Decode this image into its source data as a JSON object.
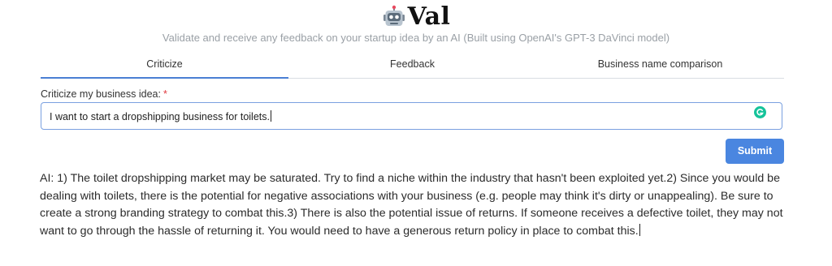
{
  "app": {
    "icon": "robot-icon",
    "name": "Val",
    "subtitle": "Validate and receive any feedback on your startup idea by an AI (Built using OpenAI's GPT-3 DaVinci model)"
  },
  "tabs": [
    {
      "label": "Criticize",
      "active": true
    },
    {
      "label": "Feedback",
      "active": false
    },
    {
      "label": "Business name comparison",
      "active": false
    }
  ],
  "form": {
    "label": "Criticize my business idea:",
    "required_marker": "*",
    "input_value": "I want to start a dropshipping business for toilets.",
    "submit_label": "Submit"
  },
  "response": {
    "text": "AI: 1) The toilet dropshipping market may be saturated. Try to find a niche within the industry that hasn't been exploited yet.2) Since you would be dealing with toilets, there is the potential for negative associations with your business (e.g. people may think it's dirty or unappealing). Be sure to create a strong branding strategy to combat this.3) There is also the potential issue of returns. If someone receives a defective toilet, they may not want to go through the hassle of returning it. You would need to have a generous return policy in place to combat this."
  },
  "colors": {
    "accent": "#4a86e0",
    "active_tab_underline": "#4a7fd4",
    "required": "#e0383e",
    "grammarly": "#15c39a"
  }
}
